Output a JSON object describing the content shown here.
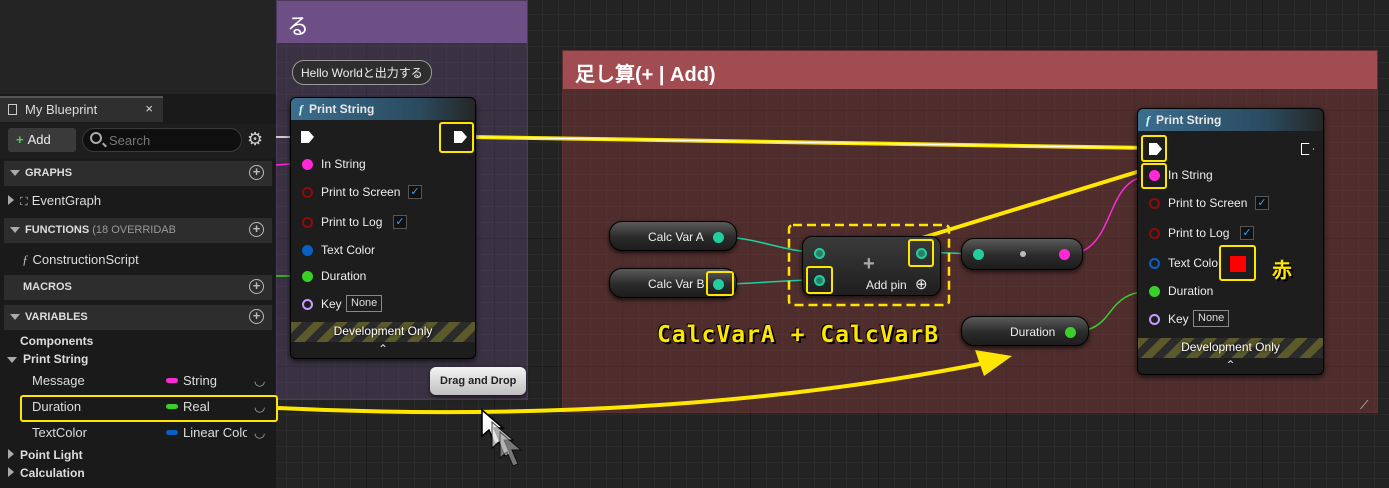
{
  "colors": {
    "highlight": "#ffe600",
    "string_pin": "#ff29d5",
    "bool_pin": "#8a0d0d",
    "struct_pin": "#0a5fc0",
    "float_pin": "#3ad02a",
    "name_pin": "#c89cff",
    "calc_pin": "#1fcf9d",
    "text_color_swatch": "#ff0000"
  },
  "graph": {
    "comment_purple_title": "る",
    "comment_red_title": "足し算(+ | Add)",
    "hello_tooltip": "Hello Worldと出力する",
    "drag_drop_label": "Drag and Drop",
    "formula_label": "CalcVarA + CalcVarB",
    "red_label": "赤"
  },
  "node_left": {
    "title": "Print String",
    "func_icon": "f",
    "pins": {
      "in_string": "In String",
      "print_to_screen": "Print to Screen",
      "print_to_log": "Print to Log",
      "text_color": "Text Color",
      "duration": "Duration",
      "key": "Key"
    },
    "key_value": "None",
    "dev_only": "Development Only",
    "checked_screen": "✓",
    "checked_log": "✓"
  },
  "node_right": {
    "title": "Print String",
    "func_icon": "f",
    "pins": {
      "in_string": "In String",
      "print_to_screen": "Print to Screen",
      "print_to_log": "Print to Log",
      "text_color": "Text Colo",
      "duration": "Duration",
      "key": "Key"
    },
    "key_value": "None",
    "dev_only": "Development Only",
    "checked_screen": "✓",
    "checked_log": "✓"
  },
  "var_nodes": {
    "calc_a": "Calc Var A",
    "calc_b": "Calc Var B",
    "duration": "Duration"
  },
  "add_node": {
    "symbol": "+",
    "add_pin_label": "Add pin",
    "add_pin_icon": "⊕"
  },
  "panel": {
    "tab_title": "My Blueprint",
    "tab_close": "×",
    "add_button": "Add",
    "add_plus": "+",
    "search_placeholder": "Search",
    "sections": {
      "graphs": "GRAPHS",
      "functions": "FUNCTIONS",
      "functions_count": "(18 OVERRIDAB",
      "macros": "MACROS",
      "variables": "VARIABLES"
    },
    "event_graph": "EventGraph",
    "construction_script": "ConstructionScript",
    "categories": [
      "Components",
      "Print String",
      "Point Light",
      "Calculation"
    ],
    "variables": [
      {
        "name": "Message",
        "type": "String",
        "color": "#ff29d5"
      },
      {
        "name": "Duration",
        "type": "Real",
        "color": "#3ad02a"
      },
      {
        "name": "TextColor",
        "type": "Linear Colo",
        "color": "#0a5fc0"
      }
    ]
  }
}
